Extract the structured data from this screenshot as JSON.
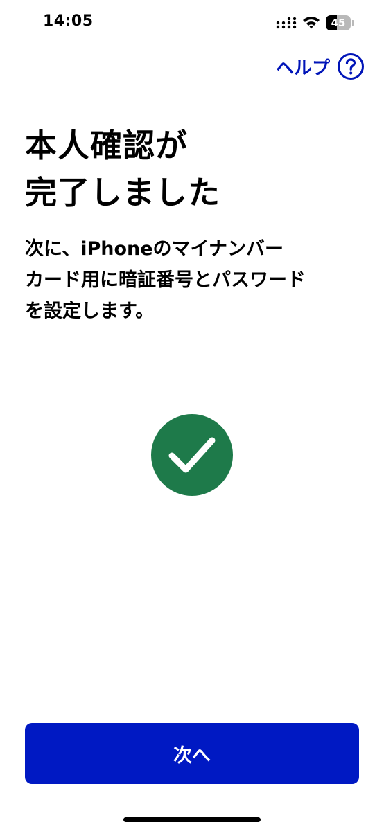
{
  "status_bar": {
    "time": "14:05",
    "battery_level": 45,
    "battery_label": "45"
  },
  "header": {
    "help_label": "ヘルプ",
    "help_icon": "question-circle-icon"
  },
  "main": {
    "title_line1": "本人確認が",
    "title_line2": "完了しました",
    "description_line1": "次に、iPhoneのマイナンバー",
    "description_line2": "カード用に暗証番号とパスワード",
    "description_line3": "を設定します。",
    "status_icon": "checkmark-icon"
  },
  "footer": {
    "next_label": "次へ"
  },
  "colors": {
    "accent": "#0019c3",
    "link": "#0014b8",
    "success": "#1e7a4a",
    "background": "#ffffff",
    "text": "#000000"
  }
}
